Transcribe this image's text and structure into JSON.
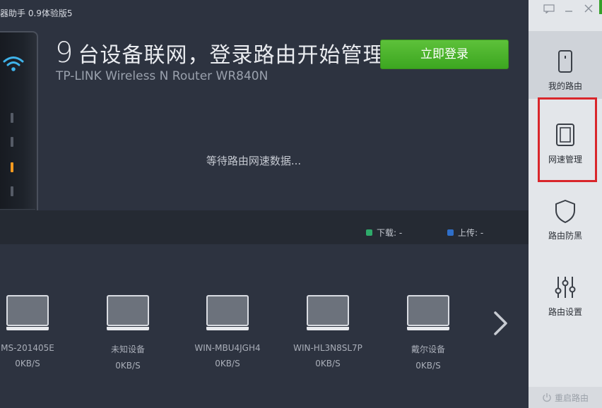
{
  "app": {
    "title": "器助手 0.9体验版5"
  },
  "header": {
    "device_count": "9",
    "headline": "台设备联网，登录路由开始管理",
    "model": "TP-LINK Wireless N Router WR840N",
    "login_button": "立即登录"
  },
  "status": {
    "waiting": "等待路由网速数据..."
  },
  "speed": {
    "download_label": "下载: -",
    "upload_label": "上传: -",
    "download_color": "#2eaa6a",
    "upload_color": "#2f6fc9"
  },
  "devices": [
    {
      "name": "MS-201405E",
      "speed": "0KB/S"
    },
    {
      "name": "未知设备",
      "speed": "0KB/S"
    },
    {
      "name": "WIN-MBU4JGH4",
      "speed": "0KB/S"
    },
    {
      "name": "WIN-HL3N8SL7P",
      "speed": "0KB/S"
    },
    {
      "name": "戴尔设备",
      "speed": "0KB/S"
    }
  ],
  "sidebar": {
    "items": [
      {
        "label": "我的路由",
        "icon": "phone-icon"
      },
      {
        "label": "网速管理",
        "icon": "tablet-icon"
      },
      {
        "label": "路由防黑",
        "icon": "shield-icon"
      },
      {
        "label": "路由设置",
        "icon": "sliders-icon"
      }
    ],
    "reboot_label": "重启路由"
  },
  "colors": {
    "accent_green": "#4cb52f",
    "highlight_red": "#d9262b"
  }
}
